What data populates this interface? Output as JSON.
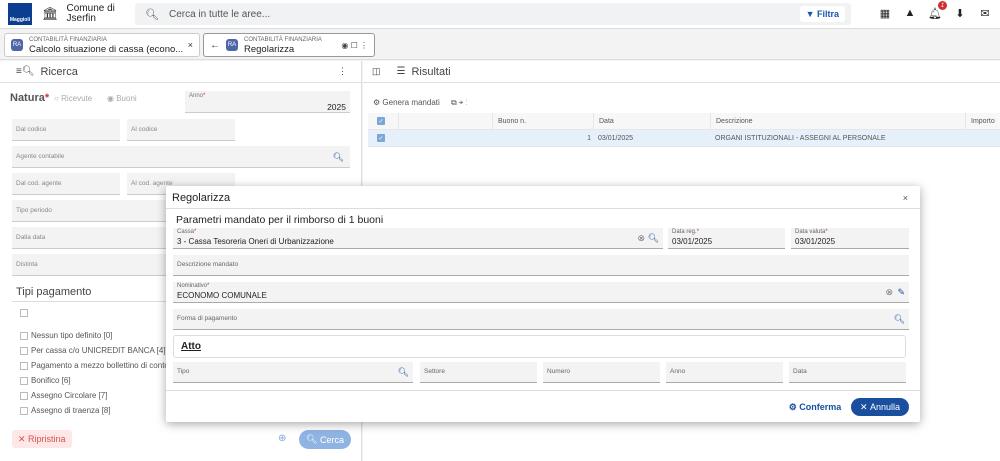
{
  "topbar": {
    "logo_text": "Maggioli",
    "org_line1": "Comune di",
    "org_line2": "Jserfin",
    "search_placeholder": "Cerca in tutte le aree...",
    "filter_label": "Filtra",
    "notifications_count": "1"
  },
  "tabs": [
    {
      "icon": "RA",
      "subtitle": "CONTABILITÀ FINANZIARIA",
      "title": "Calcolo situazione di cassa (econo...",
      "close": "×"
    },
    {
      "icon": "RA",
      "subtitle": "CONTABILITÀ FINANZIARIA",
      "title": "Regolarizza",
      "close": ""
    }
  ],
  "left": {
    "title": "Ricerca",
    "natura_label": "Natura",
    "natura_options": [
      "Ricevute",
      "Buoni"
    ],
    "anno_label": "Anno",
    "anno_value": "2025",
    "fields": {
      "dal_codice": "Dal codice",
      "al_codice": "Al codice",
      "agente": "Agente contabile",
      "dal_cod_agente": "Dal cod. agente",
      "al_cod_agente": "Al cod. agente",
      "tipo_periodo": "Tipo periodo",
      "dalla_data": "Dalla data",
      "distinta": "Distinta"
    },
    "tipi_title": "Tipi pagamento",
    "tipi": [
      "Nessun tipo definito [0]",
      "Per cassa c/o UNICREDIT BANCA [4]",
      "Pagamento a mezzo bollettino di conto",
      "Bonifico [6]",
      "Assegno Circolare [7]",
      "Assegno di traenza [8]"
    ],
    "ripristina": "Ripristina",
    "cerca": "Cerca"
  },
  "right": {
    "title": "Risultati",
    "genera": "Genera mandati",
    "columns": [
      "Buono n.",
      "Data",
      "Descrizione",
      "Importo"
    ],
    "rows": [
      {
        "buono": "1",
        "data": "03/01/2025",
        "descrizione": "ORGANI ISTITUZIONALI - ASSEGNI AL PERSONALE"
      }
    ]
  },
  "modal": {
    "title": "Regolarizza",
    "close": "×",
    "subtitle": "Parametri mandato per il rimborso di 1 buoni",
    "cassa_label": "Cassa",
    "cassa_value": "3 - Cassa Tesoreria Oneri di Urbanizzazione",
    "data_reg_label": "Data reg.",
    "data_reg_value": "03/01/2025",
    "data_valuta_label": "Data valuta",
    "data_valuta_value": "03/01/2025",
    "descrizione_label": "Descrizione mandato",
    "nominativo_label": "Nominativo",
    "nominativo_value": "ECONOMO COMUNALE",
    "forma_label": "Forma di pagamento",
    "atto_title": "Atto",
    "atto_fields": [
      "Tipo",
      "Settore",
      "Numero",
      "Anno",
      "Data"
    ],
    "conferma": "Conferma",
    "annulla": "Annulla"
  }
}
